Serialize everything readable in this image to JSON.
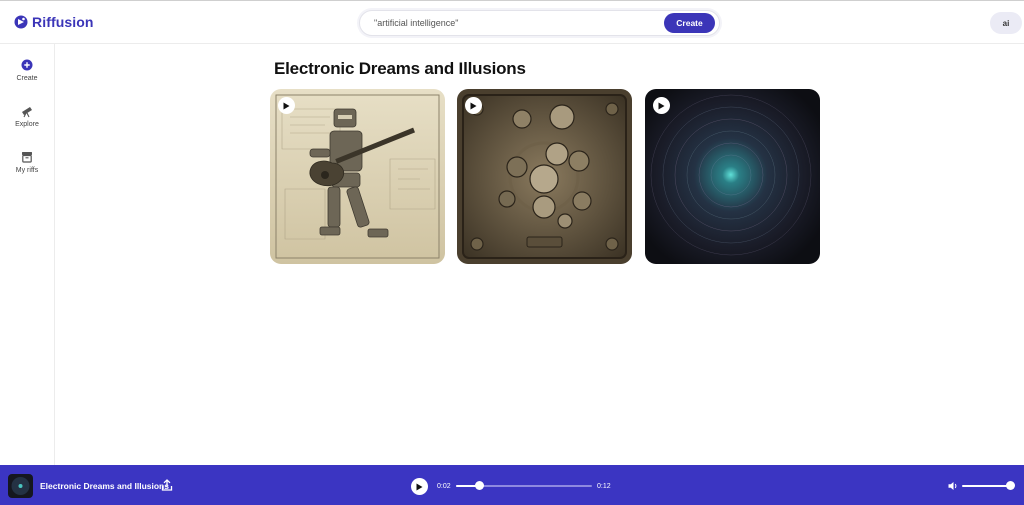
{
  "app": {
    "name": "Riffusion",
    "brand_color": "#3b35b8",
    "player_color": "#3b35c2"
  },
  "search": {
    "value": "\"artificial intelligence\"",
    "placeholder": "",
    "button_label": "Create"
  },
  "user": {
    "avatar_label": "ai"
  },
  "sidebar": {
    "items": [
      {
        "label": "Create",
        "icon": "plus-circle-icon",
        "active": true
      },
      {
        "label": "Explore",
        "icon": "telescope-icon",
        "active": false
      },
      {
        "label": "My riffs",
        "icon": "archive-box-icon",
        "active": false
      }
    ]
  },
  "main": {
    "title": "Electronic Dreams and Illusions",
    "cards": [
      {
        "image": "robot-playing-guitar-sketch",
        "icon": "play-icon"
      },
      {
        "image": "steampunk-gears-machine",
        "icon": "play-icon"
      },
      {
        "image": "cosmic-vortex-dark",
        "icon": "play-icon"
      }
    ]
  },
  "player": {
    "track_title": "Electronic Dreams and Illusions",
    "current_time": "0:02",
    "duration": "0:12",
    "progress": 0.17,
    "volume": 1.0
  }
}
